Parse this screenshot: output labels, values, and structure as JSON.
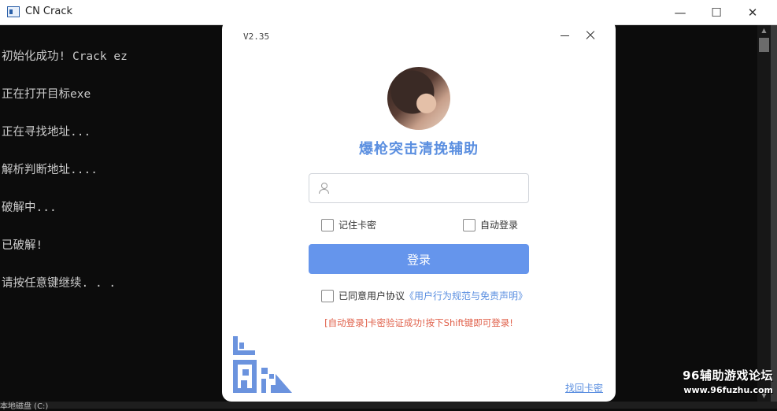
{
  "console": {
    "title": "CN Crack",
    "controls": {
      "minimize": "—",
      "maximize": "☐",
      "close": "✕"
    },
    "lines": [
      "初始化成功! Crack ez",
      "正在打开目标exe",
      "正在寻找地址...",
      "解析判断地址....",
      "破解中...",
      "已破解!",
      "请按任意键继续. . ."
    ],
    "taskbar_text": "本地磁盘 (C:)"
  },
  "dialog": {
    "version": "V2.35",
    "brand": "爆枪突击清挽辅助",
    "card_input": {
      "value": "",
      "placeholder": ""
    },
    "remember_label": "记住卡密",
    "auto_login_label": "自动登录",
    "login_label": "登录",
    "agree_prefix": "已同意用户协议",
    "agree_link": "《用户行为规范与免责声明》",
    "status_message": "[自动登录]卡密验证成功!按下Shift键即可登录!",
    "find_card_label": "找回卡密"
  },
  "watermark": {
    "line1": "96辅助游戏论坛",
    "line2": "www.96fuzhu.com"
  },
  "colors": {
    "accent": "#6595ec",
    "status": "#e0604a",
    "console_bg": "#0c0c0c"
  }
}
